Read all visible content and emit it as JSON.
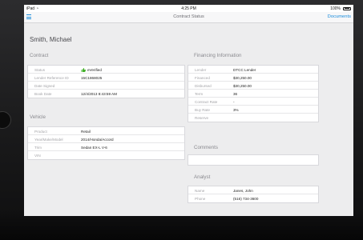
{
  "status_bar": {
    "device": "iPad",
    "time": "4:25 PM",
    "battery": "100%"
  },
  "nav": {
    "title": "Contract Status",
    "documents_label": "Documents"
  },
  "customer": {
    "name": "Smith, Michael"
  },
  "contract": {
    "title": "Contract",
    "rows": [
      {
        "label": "Status",
        "value": "eVerified"
      },
      {
        "label": "Lender Reference ID",
        "value": "15C1868025"
      },
      {
        "label": "Date Signed",
        "value": ""
      },
      {
        "label": "Book Date",
        "value": "12/4/2013 8:43:59 AM"
      }
    ]
  },
  "vehicle": {
    "title": "Vehicle",
    "rows": [
      {
        "label": "Product",
        "value": "Retail"
      },
      {
        "label": "Year/Make/Model",
        "value": "2014/Honda/Accord"
      },
      {
        "label": "Trim",
        "value": "Sedan EX-L V-6"
      },
      {
        "label": "VIN",
        "value": ""
      }
    ]
  },
  "financing": {
    "title": "Financing Information",
    "rows": [
      {
        "label": "Lender",
        "value": "DTCC Lender"
      },
      {
        "label": "Financed",
        "value": "$30,250.00"
      },
      {
        "label": "Disbursed",
        "value": "$30,250.00"
      },
      {
        "label": "Term",
        "value": "36"
      },
      {
        "label": "Contract Rate",
        "value": "-"
      },
      {
        "label": "Buy Rate",
        "value": "3%"
      },
      {
        "label": "Reserve",
        "value": ""
      }
    ]
  },
  "comments": {
    "title": "Comments",
    "value": ""
  },
  "analyst": {
    "title": "Analyst",
    "rows": [
      {
        "label": "Name",
        "value": "Janes, John"
      },
      {
        "label": "Phone",
        "value": "(516) 734-3600"
      }
    ]
  },
  "colors": {
    "accent": "#1a8cdb",
    "verified": "#43b02a"
  }
}
